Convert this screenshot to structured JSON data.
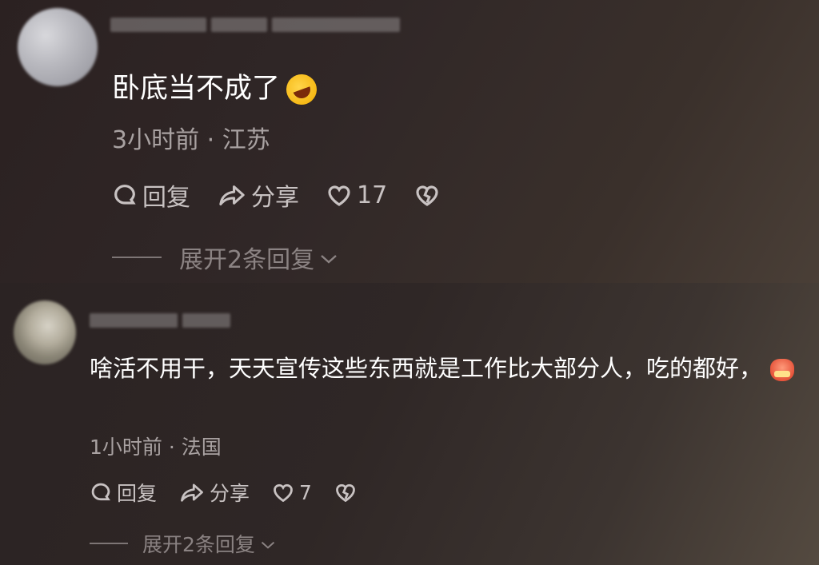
{
  "comments": [
    {
      "text": "卧底当不成了",
      "emoji": "rofl-emoji",
      "time": "3小时前",
      "location": "江苏",
      "reply_label": "回复",
      "share_label": "分享",
      "likes": "17",
      "expand_label": "展开2条回复"
    },
    {
      "text": "啥活不用干，天天宣传这些东西就是工作比大部分人，吃的都好，",
      "emoji": "angry-face-emoji",
      "time": "1小时前",
      "location": "法国",
      "reply_label": "回复",
      "share_label": "分享",
      "likes": "7",
      "expand_label": "展开2条回复"
    }
  ],
  "separator": "·",
  "colors": {
    "text_primary": "#ffffff",
    "text_meta": "#a9a2a2",
    "action": "#c8c2c2",
    "muted": "#8b8383"
  }
}
